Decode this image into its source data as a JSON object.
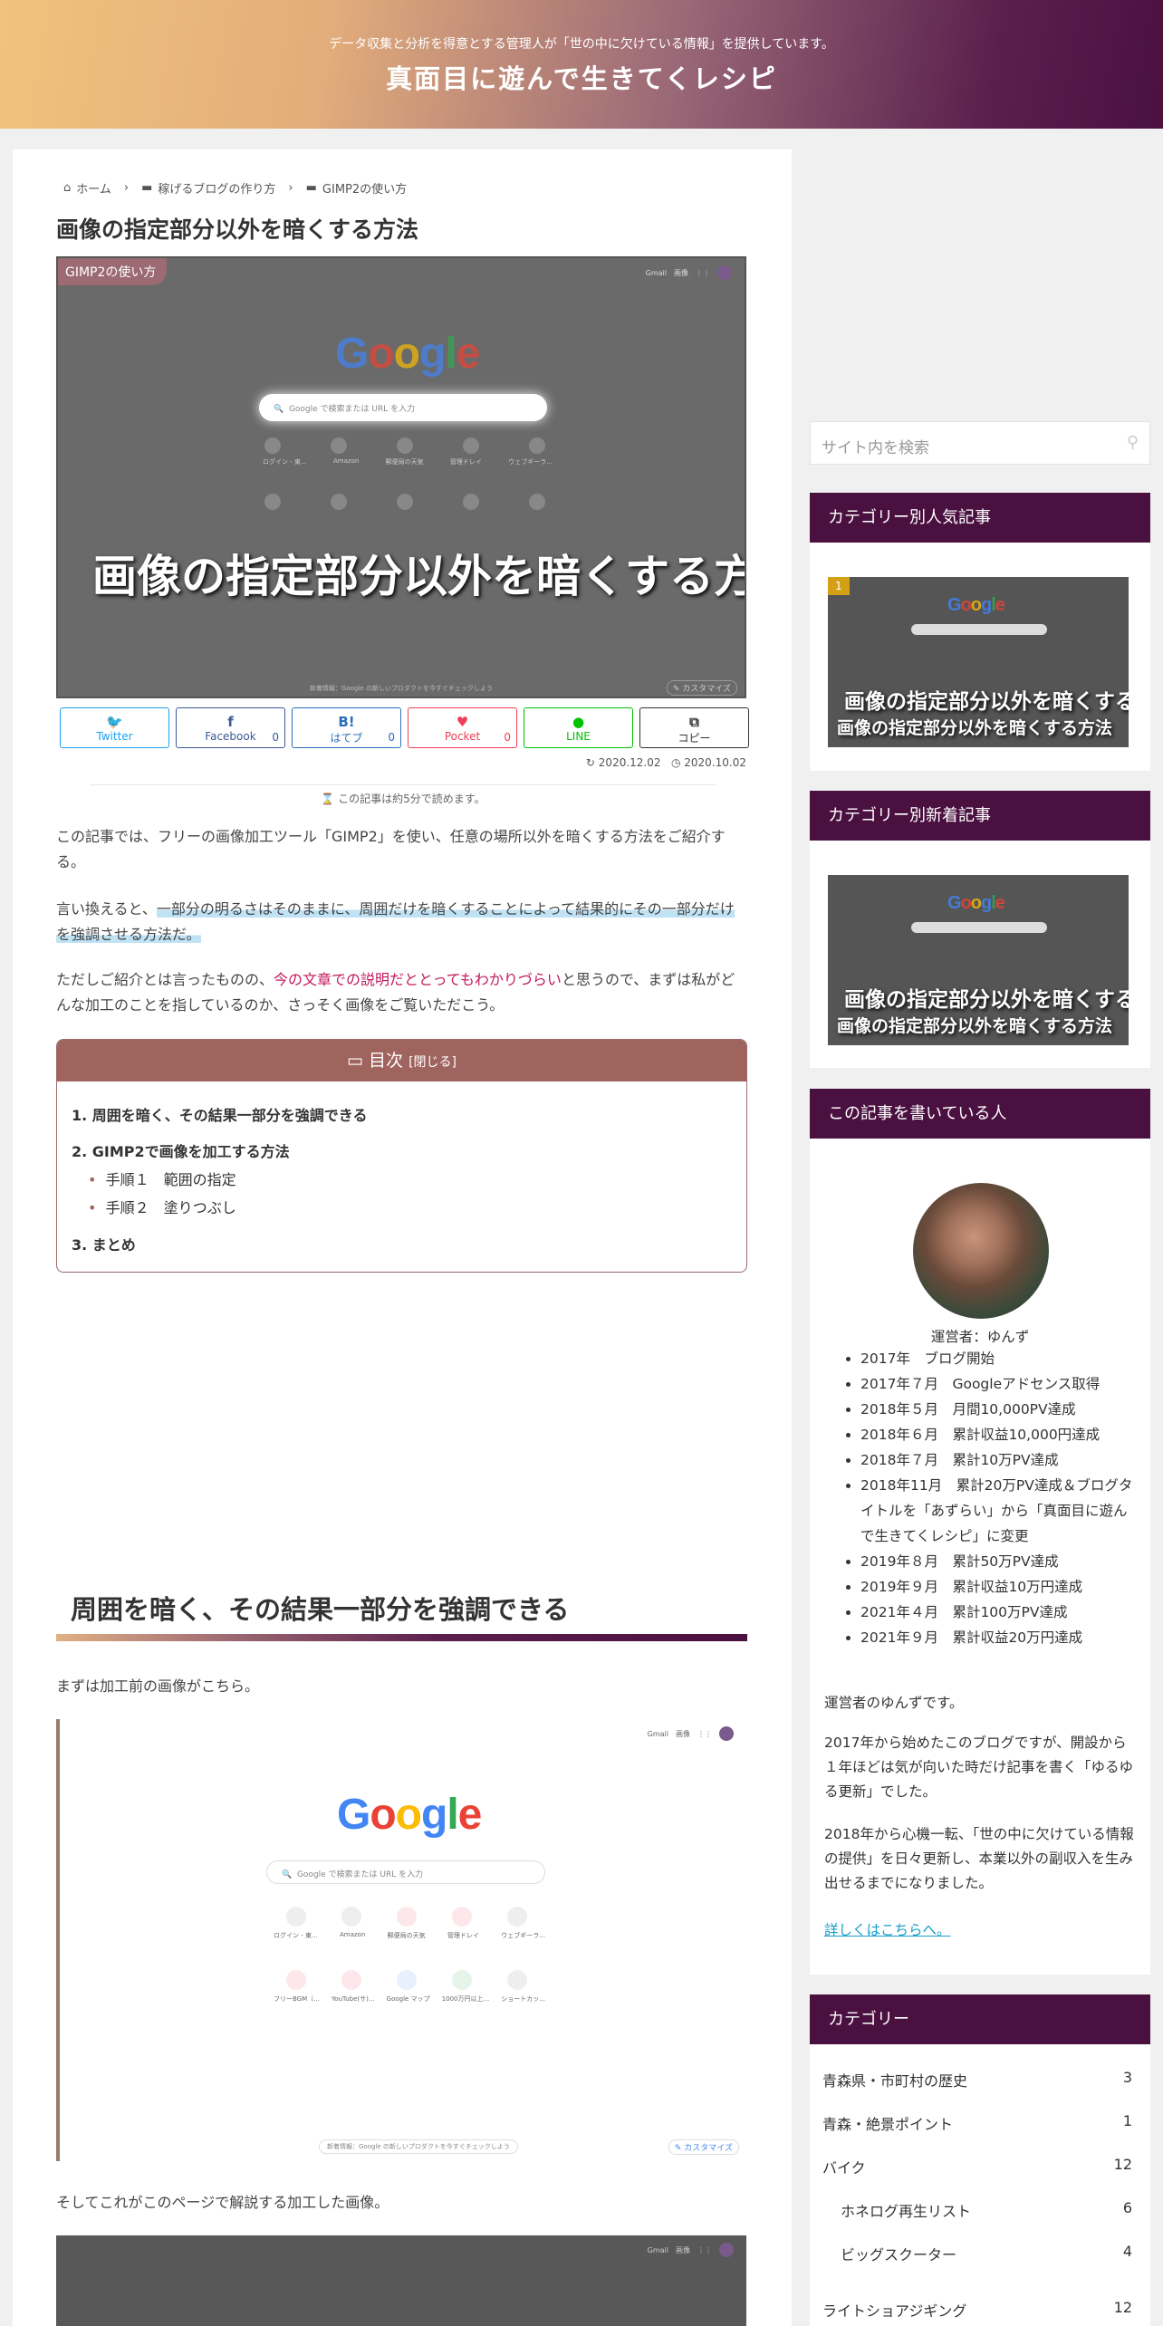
{
  "header": {
    "description": "データ収集と分析を得意とする管理人が「世の中に欠けている情報」を提供しています。",
    "site_title": "真面目に遊んで生きてくレシピ"
  },
  "breadcrumb": {
    "home": "ホーム",
    "cat1": "稼げるブログの作り方",
    "cat2": "GIMP2の使い方"
  },
  "article": {
    "title": "画像の指定部分以外を暗くする方法",
    "category_badge": "GIMP2の使い方",
    "eyecatch_text": "画像の指定部分以外を暗くする方法",
    "eyecatch_customize": "カスタマイズ",
    "eyecatch_footer": "新着情報：Google の新しいプロダクトを今すぐチェックしよう",
    "google_search_placeholder": "Google で検索または URL を入力",
    "google_topbar": [
      "Gmail",
      "画像"
    ],
    "google_shortcuts_row1": [
      "ログイン - 東...",
      "Amazon",
      "郵便局の天気",
      "管理ドレイ",
      "ウェブギーラ..."
    ],
    "google_shortcuts_row2": [
      "フリーBGM（...",
      "YouTube(サ)...",
      "Google マップ",
      "1000万円以上...",
      "ショートカッ..."
    ],
    "published": "2020.12.02",
    "updated": "2020.10.02",
    "read_time": "この記事は約5分で読めます。",
    "intro": "この記事では、フリーの画像加工ツール「GIMP2」を使い、任意の場所以外を暗くする方法をご紹介する。",
    "para2_pre": "言い換えると、",
    "para2_hl": "一部分の明るさはそのままに、周囲だけを暗くすることによって結果的にその一部分だけを強調させる方法だ。",
    "para3_pre": "ただしご紹介とは言ったものの、",
    "para3_red": "今の文章での説明だととってもわかりづらい",
    "para3_post": "と思うので、まずは私がどんな加工のことを指しているのか、さっそく画像をご覧いただこう。",
    "h2_1": "周囲を暗く、その結果一部分を強調できる",
    "before_text": "まずは加工前の画像がこちら。",
    "after_text": "そしてこれがこのページで解説する加工した画像。"
  },
  "share": [
    {
      "icon": "twitter-icon",
      "glyph": "🐦",
      "label": "Twitter",
      "count": "",
      "color": "#1da1f2"
    },
    {
      "icon": "facebook-icon",
      "glyph": "f",
      "label": "Facebook",
      "count": "0",
      "color": "#3b5998"
    },
    {
      "icon": "hatena-icon",
      "glyph": "B!",
      "label": "はてブ",
      "count": "0",
      "color": "#2c6ebd"
    },
    {
      "icon": "pocket-icon",
      "glyph": "♥",
      "label": "Pocket",
      "count": "0",
      "color": "#ef4056"
    },
    {
      "icon": "line-icon",
      "glyph": "●",
      "label": "LINE",
      "count": "",
      "color": "#00c300"
    },
    {
      "icon": "copy-icon",
      "glyph": "⧉",
      "label": "コピー",
      "count": "",
      "color": "#333333"
    }
  ],
  "toc": {
    "title": "目次",
    "toggle": "[閉じる]",
    "items": [
      "1. 周囲を暗く、その結果一部分を強調できる",
      "2. GIMP2で画像を加工する方法",
      "手順１　範囲の指定",
      "手順２　塗りつぶし",
      "3. まとめ"
    ]
  },
  "sidebar": {
    "search_placeholder": "サイト内を検索",
    "popular_title": "カテゴリー別人気記事",
    "popular_rank": "1",
    "popular_item": "画像の指定部分以外を暗くする方法",
    "new_title": "カテゴリー別新着記事",
    "new_item": "画像の指定部分以外を暗くする方法",
    "author_title": "この記事を書いている人",
    "author_name": "運営者：ゆんず",
    "history": [
      "2017年　ブログ開始",
      "2017年７月　Googleアドセンス取得",
      "2018年５月　月間10,000PV達成",
      "2018年６月　累計収益10,000円達成",
      "2018年７月　累計10万PV達成",
      "2018年11月　累計20万PV達成＆ブログタイトルを「あずらい」から「真面目に遊んで生きてくレシピ」に変更",
      "2019年８月　累計50万PV達成",
      "2019年９月　累計収益10万円達成",
      "2021年４月　累計100万PV達成",
      "2021年９月　累計収益20万円達成"
    ],
    "bio1": "運営者のゆんずです。",
    "bio2": "2017年から始めたこのブログですが、開設から１年ほどは気が向いた時だけ記事を書く「ゆるゆる更新」でした。",
    "bio3": "2018年から心機一転、「世の中に欠けている情報の提供」を日々更新し、本業以外の副収入を生み出せるまでになりました。",
    "more_link": "詳しくはこちらへ。",
    "categories_title": "カテゴリー",
    "categories": [
      {
        "name": "青森県・市町村の歴史",
        "count": "3"
      },
      {
        "name": "青森・絶景ポイント",
        "count": "1"
      },
      {
        "name": "バイク",
        "count": "12"
      },
      {
        "name": "ホネログ再生リスト",
        "count": "6"
      },
      {
        "name": "ビッグスクーター",
        "count": "4"
      },
      {
        "name": "ライトショアジギング",
        "count": "12"
      }
    ]
  }
}
